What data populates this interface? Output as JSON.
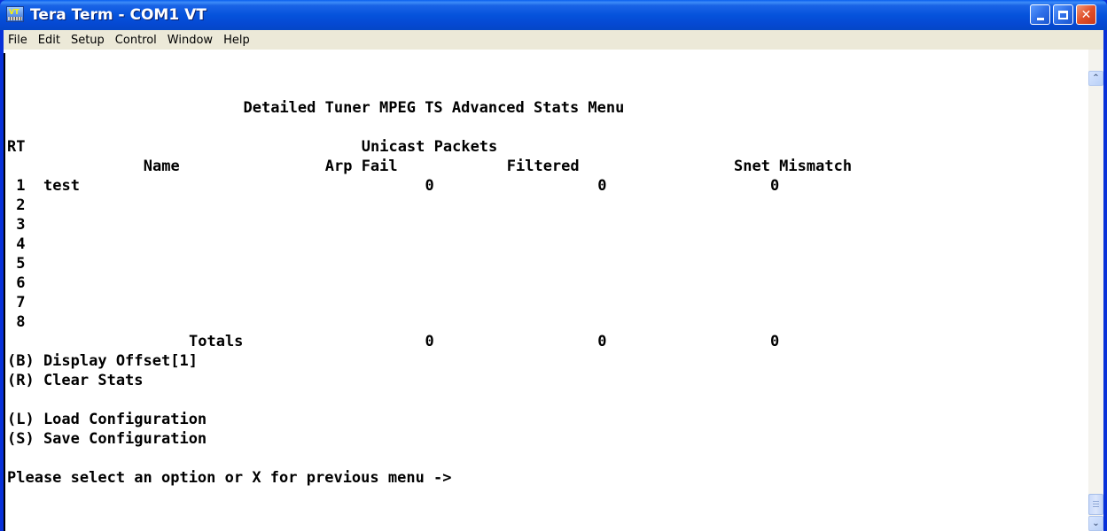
{
  "window": {
    "title": "Tera Term - COM1 VT",
    "icon": "teraterm-app-icon"
  },
  "titlebar_buttons": {
    "minimize_icon": "minimize-icon",
    "maximize_icon": "maximize-icon",
    "close_glyph": "✕"
  },
  "menu": {
    "items": [
      "File",
      "Edit",
      "Setup",
      "Control",
      "Window",
      "Help"
    ]
  },
  "terminal": {
    "heading": "Detailed Tuner MPEG TS Advanced Stats Menu",
    "rt_label": "RT",
    "group_label": "Unicast Packets",
    "columns": {
      "name": "Name",
      "arp_fail": "Arp Fail",
      "filtered": "Filtered",
      "snet_mismatch": "Snet Mismatch"
    },
    "rows": [
      {
        "index": "1",
        "name": "test",
        "arp_fail": "0",
        "filtered": "0",
        "snet_mismatch": "0"
      },
      {
        "index": "2",
        "name": "",
        "arp_fail": "",
        "filtered": "",
        "snet_mismatch": ""
      },
      {
        "index": "3",
        "name": "",
        "arp_fail": "",
        "filtered": "",
        "snet_mismatch": ""
      },
      {
        "index": "4",
        "name": "",
        "arp_fail": "",
        "filtered": "",
        "snet_mismatch": ""
      },
      {
        "index": "5",
        "name": "",
        "arp_fail": "",
        "filtered": "",
        "snet_mismatch": ""
      },
      {
        "index": "6",
        "name": "",
        "arp_fail": "",
        "filtered": "",
        "snet_mismatch": ""
      },
      {
        "index": "7",
        "name": "",
        "arp_fail": "",
        "filtered": "",
        "snet_mismatch": ""
      },
      {
        "index": "8",
        "name": "",
        "arp_fail": "",
        "filtered": "",
        "snet_mismatch": ""
      }
    ],
    "totals": {
      "label": "Totals",
      "arp_fail": "0",
      "filtered": "0",
      "snet_mismatch": "0"
    },
    "options": [
      "(B) Display Offset[1]",
      "(R) Clear Stats",
      "",
      "(L) Load Configuration",
      "(S) Save Configuration"
    ],
    "prompt": "Please select an option or X for previous menu ->"
  },
  "scrollbar": {
    "up_glyph": "⌃",
    "down_glyph": "⌄"
  }
}
